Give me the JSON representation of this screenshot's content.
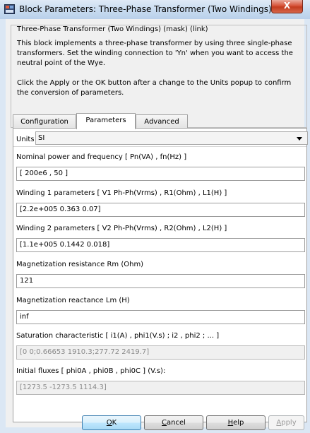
{
  "window": {
    "title": "Block Parameters: Three-Phase Transformer (Two Windings)",
    "close_label": "X"
  },
  "mask": {
    "title": "Three-Phase Transformer (Two Windings) (mask) (link)",
    "description": "This block implements a three-phase transformer by using three single-phase transformers. Set the winding connection to 'Yn'  when you want to access the neutral point of the Wye.",
    "note": "Click the Apply or the OK button after a change to the Units popup to confirm the conversion of parameters."
  },
  "tabs": [
    {
      "label": "Configuration",
      "active": false
    },
    {
      "label": "Parameters",
      "active": true
    },
    {
      "label": "Advanced",
      "active": false
    }
  ],
  "units": {
    "label": "Units",
    "value": "SI"
  },
  "params": [
    {
      "label": "Nominal power and frequency  [ Pn(VA) , fn(Hz) ]",
      "value": "[ 200e6 , 50 ]",
      "enabled": true
    },
    {
      "label": "Winding 1 parameters [ V1 Ph-Ph(Vrms) , R1(Ohm) , L1(H) ]",
      "value": "[2.2e+005 0.363 0.07]",
      "enabled": true
    },
    {
      "label": "Winding 2 parameters [ V2 Ph-Ph(Vrms) , R2(Ohm) , L2(H) ]",
      "value": "[1.1e+005 0.1442 0.018]",
      "enabled": true
    },
    {
      "label": "Magnetization resistance  Rm (Ohm)",
      "value": "121",
      "enabled": true
    },
    {
      "label": "Magnetization reactance  Lm (H)",
      "value": "inf",
      "enabled": true
    },
    {
      "label": "Saturation characteristic [ i1(A) ,  phi1(V.s) ;  i2 , phi2 ; ... ]",
      "value": "[0 0;0.66653 1910.3;277.72 2419.7]",
      "enabled": false
    },
    {
      "label": "Initial fluxes [ phi0A , phi0B , phi0C ] (V.s):",
      "value": "[1273.5 -1273.5 1114.3]",
      "enabled": false
    }
  ],
  "buttons": {
    "ok": {
      "mnemonic": "O",
      "rest": "K"
    },
    "cancel": {
      "mnemonic": "C",
      "rest": "ancel"
    },
    "help": {
      "mnemonic": "H",
      "rest": "elp"
    },
    "apply": {
      "mnemonic": "A",
      "rest": "pply"
    }
  },
  "colors": {
    "close_button": "#c9462a",
    "title_bar": "#c9dcf0",
    "frame": "#dbe7f4"
  }
}
